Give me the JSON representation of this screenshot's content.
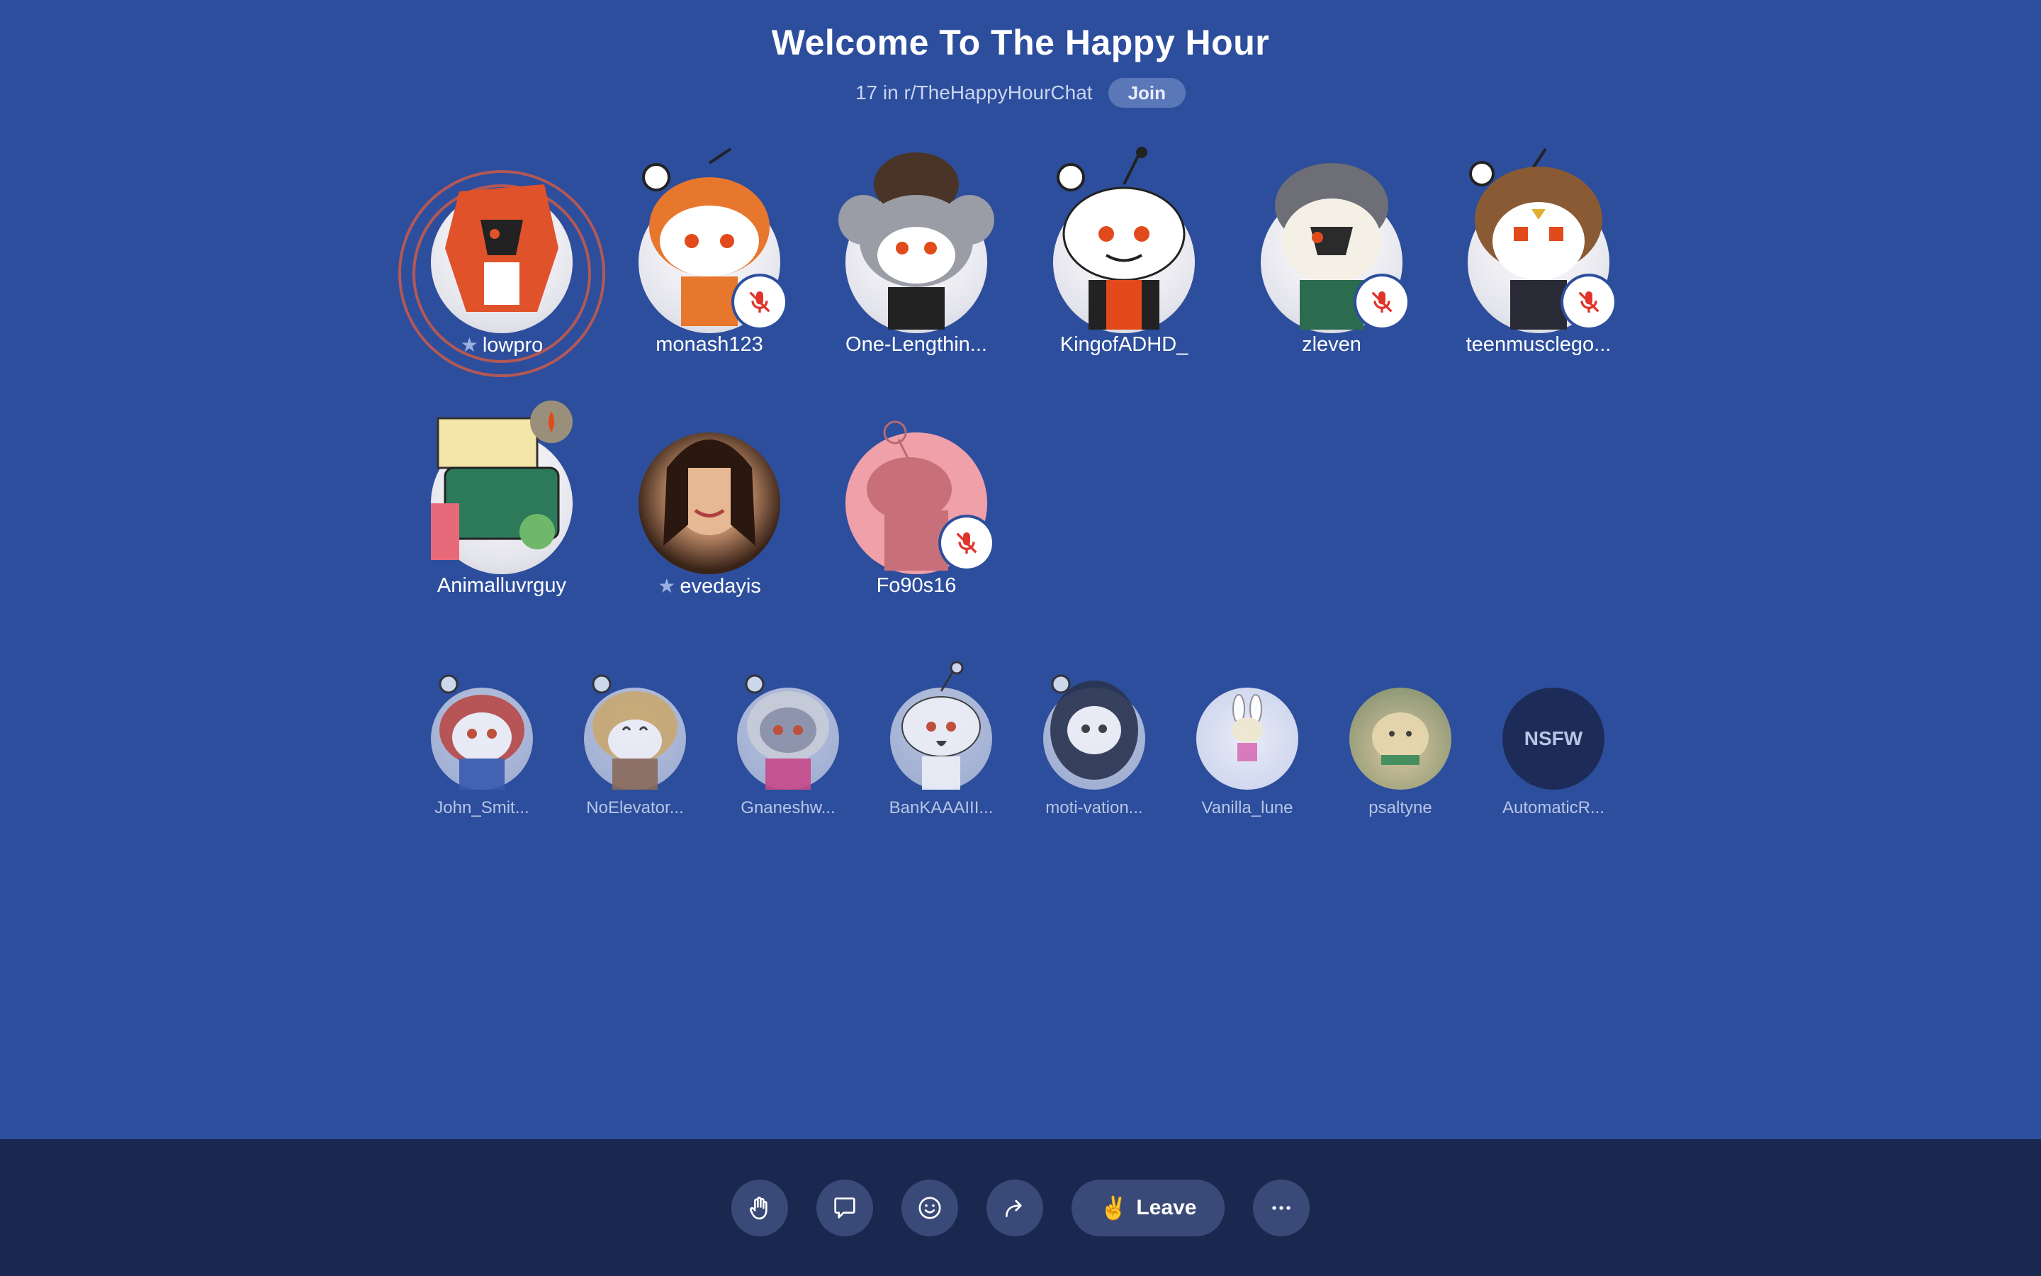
{
  "room": {
    "title": "Welcome To The Happy Hour",
    "community": "17 in r/TheHappyHourChat",
    "join_label": "Join"
  },
  "speakers": [
    {
      "name": "lowpro",
      "host": true,
      "muted": false,
      "speaking": true,
      "color": "#e0522a"
    },
    {
      "name": "monash123",
      "host": false,
      "muted": true,
      "color": "#e8772e"
    },
    {
      "name": "One-Lengthin...",
      "host": false,
      "muted": false,
      "color": "#8a8d96"
    },
    {
      "name": "KingofADHD_",
      "host": false,
      "muted": false,
      "color": "#e24a1b"
    },
    {
      "name": "zleven",
      "host": false,
      "muted": true,
      "color": "#2b6b4e"
    },
    {
      "name": "teenmusclego...",
      "host": false,
      "muted": true,
      "color": "#8a5a34"
    },
    {
      "name": "Animalluvrguy",
      "host": false,
      "muted": false,
      "color": "#2d7a5a"
    },
    {
      "name": "evedayis",
      "host": true,
      "muted": false,
      "color": "#5a3a2a"
    },
    {
      "name": "Fo90s16",
      "host": false,
      "muted": true,
      "color": "#f0a0a8"
    }
  ],
  "listeners": [
    {
      "name": "John_Smit..."
    },
    {
      "name": "NoElevator..."
    },
    {
      "name": "Gnaneshw..."
    },
    {
      "name": "BanKAAAIII..."
    },
    {
      "name": "moti-vation..."
    },
    {
      "name": "Vanilla_lune"
    },
    {
      "name": "psaltyne"
    },
    {
      "name": "AutomaticR...",
      "nsfw_label": "NSFW"
    }
  ],
  "controls": {
    "leave_label": "Leave",
    "icons": [
      "raise-hand-icon",
      "chat-icon",
      "emoji-icon",
      "share-icon",
      "peace-hand-icon",
      "more-icon"
    ]
  },
  "colors": {
    "background": "#2d4e9c",
    "bottombar": "#1a2850",
    "mute_red": "#e0342b"
  }
}
